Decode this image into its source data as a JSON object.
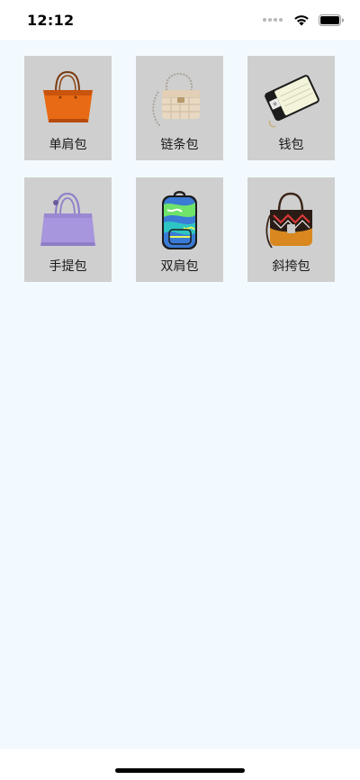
{
  "status_bar": {
    "time": "12:12"
  },
  "categories": [
    {
      "label": "单肩包",
      "icon": "shoulder-bag-icon"
    },
    {
      "label": "链条包",
      "icon": "chain-bag-icon"
    },
    {
      "label": "钱包",
      "icon": "wallet-icon"
    },
    {
      "label": "手提包",
      "icon": "handbag-icon"
    },
    {
      "label": "双肩包",
      "icon": "backpack-icon"
    },
    {
      "label": "斜挎包",
      "icon": "crossbody-bag-icon"
    }
  ],
  "colors": {
    "tile_background": "#cfcfcf",
    "page_background": "#f3faff"
  }
}
